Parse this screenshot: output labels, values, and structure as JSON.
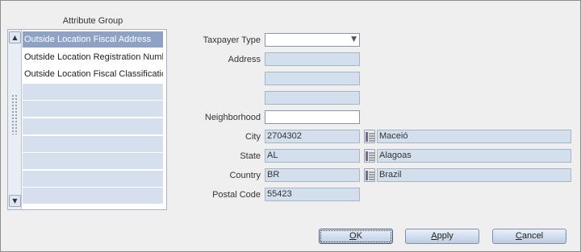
{
  "attribute_group": {
    "title": "Attribute Group",
    "items": [
      "Outside Location Fiscal Address",
      "Outside Location Registration Numb",
      "Outside Location Fiscal Classificatic",
      "",
      "",
      "",
      "",
      "",
      "",
      ""
    ],
    "selected_index": 0
  },
  "form": {
    "taxpayer_type": {
      "label": "Taxpayer Type",
      "value": ""
    },
    "address": {
      "label": "Address",
      "line1": "",
      "line2": "",
      "line3": ""
    },
    "neighborhood": {
      "label": "Neighborhood",
      "value": ""
    },
    "city": {
      "label": "City",
      "code": "2704302",
      "name": "Maceió"
    },
    "state": {
      "label": "State",
      "code": "AL",
      "name": "Alagoas"
    },
    "country": {
      "label": "Country",
      "code": "BR",
      "name": "Brazil"
    },
    "postal_code": {
      "label": "Postal Code",
      "value": "55423"
    }
  },
  "buttons": {
    "ok": {
      "prefix": "",
      "mnemonic": "O",
      "suffix": "K"
    },
    "apply": {
      "prefix": "",
      "mnemonic": "A",
      "suffix": "pply"
    },
    "cancel": {
      "prefix": "",
      "mnemonic": "C",
      "suffix": "ancel"
    }
  },
  "icons": {
    "scroll_up": "scroll-up-arrow-icon",
    "scroll_down": "scroll-down-arrow-icon",
    "dropdown": "chevron-down-icon",
    "lookup": "list-lookup-icon"
  },
  "colors": {
    "selected_row": "#8ea2c6",
    "readonly_field": "#d4dfee",
    "panel_bg": "#efefef"
  }
}
